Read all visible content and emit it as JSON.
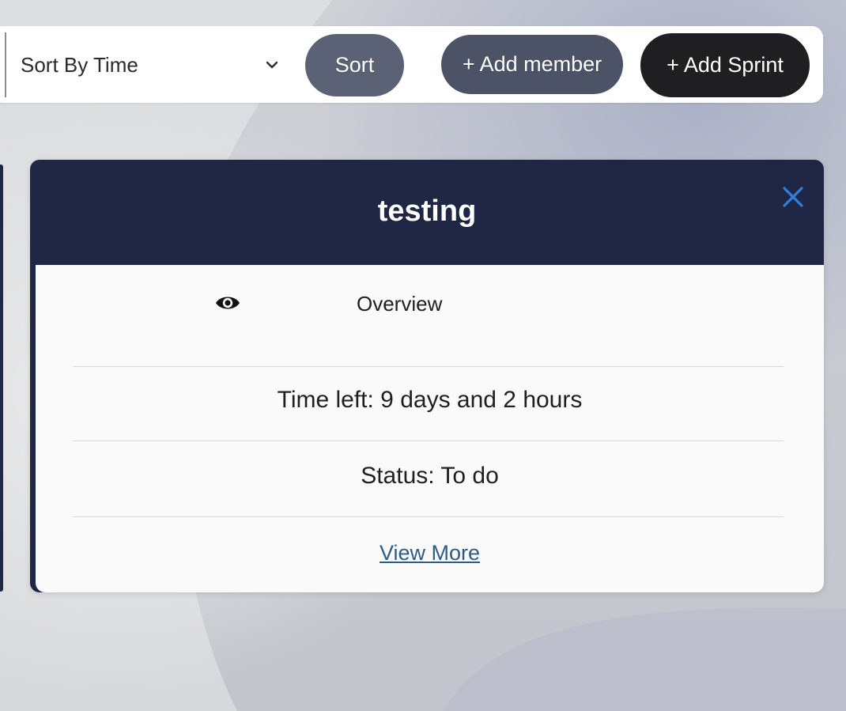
{
  "toolbar": {
    "sort_select_value": "Sort By Time",
    "sort_button_label": "Sort",
    "add_member_label": "+ Add member",
    "add_sprint_label": "+ Add Sprint"
  },
  "sprint_card": {
    "title": "testing",
    "overview_label": "Overview",
    "time_left": "Time left: 9 days and 2 hours",
    "status": "Status: To do",
    "view_more_label": "View More"
  },
  "colors": {
    "card_header": "#1f2745",
    "close_icon": "#2f7fe0",
    "link": "#2c5d8a",
    "add_sprint_button": "#1f1f22",
    "add_member_button": "#4c5367",
    "sort_button": "#5b6275"
  },
  "icons": {
    "dropdown": "chevron-down-icon",
    "close": "close-icon",
    "overview": "eye-icon"
  }
}
